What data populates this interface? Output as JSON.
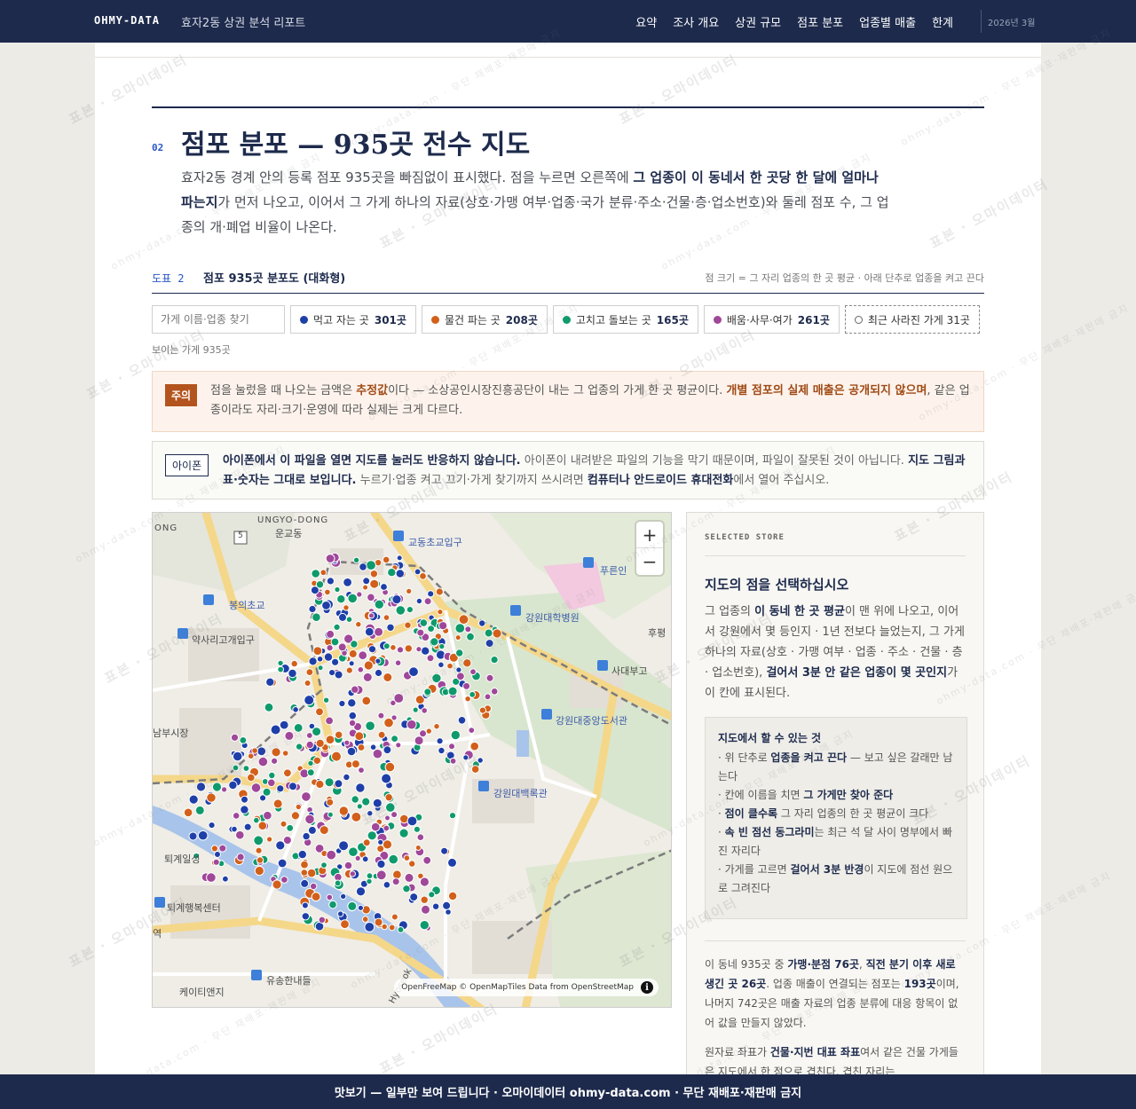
{
  "nav": {
    "brand": "OHMY-DATA",
    "subtitle": "효자2동 상권 분석 리포트",
    "links": [
      "요약",
      "조사 개요",
      "상권 규모",
      "점포 분포",
      "업종별 매출",
      "한계"
    ],
    "date": "2026년 3월"
  },
  "section": {
    "number": "02",
    "title": "점포 분포 — 935곳 전수 지도",
    "intro_1": "효자2동 경계 안의 등록 점포 935곳을 빠짐없이 표시했다. 점을 누르면 오른쪽에 ",
    "intro_bold": "그 업종이 이 동네서 한 곳당 한 달에 얼마나 파는지",
    "intro_2": "가 먼저 나오고, 이어서 그 가게 하나의 자료(상호·가맹 여부·업종·국가 분류·주소·건물·층·업소번호)와 둘레 점포 수, 그 업종의 개·폐업 비율이 나온다."
  },
  "figure": {
    "label": "도표 2",
    "title": "점포 935곳 분포도 (대화형)",
    "note": "점 크기 = 그 자리 업종의 한 곳 평균 · 아래 단추로 업종을 켜고 끈다"
  },
  "filters": {
    "search_placeholder": "가게 이름·업종 찾기",
    "chips": [
      {
        "label": "먹고 자는 곳",
        "count": "301곳",
        "color": "#1f3fa8"
      },
      {
        "label": "물건 파는 곳",
        "count": "208곳",
        "color": "#d2601a"
      },
      {
        "label": "고치고 돌보는 곳",
        "count": "165곳",
        "color": "#0f9a6c"
      },
      {
        "label": "배움·사무·여가",
        "count": "261곳",
        "color": "#a0479a"
      }
    ],
    "gone_label": "최근 사라진 가게 31곳",
    "visible_count": "보이는 가게 935곳"
  },
  "caution": {
    "tag": "주의",
    "t1": "점을 눌렀을 때 나오는 금액은 ",
    "b1": "추정값",
    "t2": "이다 — 소상공인시장진흥공단이 내는 그 업종의 가게 한 곳 평균이다. ",
    "b2": "개별 점포의 실제 매출은 공개되지 않으며",
    "t3": ", 같은 업종이라도 자리·크기·운영에 따라 실제는 크게 다르다."
  },
  "iphone": {
    "tag": "아이폰",
    "b1": "아이폰에서 이 파일을 열면 지도를 눌러도 반응하지 않습니다.",
    "t1": " 아이폰이 내려받은 파일의 기능을 막기 때문이며, 파일이 잘못된 것이 아닙니다. ",
    "b2": "지도 그림과 표·숫자는 그대로 보입니다.",
    "t2": " 누르기·업종 켜고 끄기·가게 찾기까지 쓰시려면 ",
    "b3": "컴퓨터나 안드로이드 휴대전화",
    "t3": "에서 열어 주십시오."
  },
  "map": {
    "zoom_in": "+",
    "zoom_out": "−",
    "attribution": "OpenFreeMap © OpenMapTiles Data from OpenStreetMap",
    "info": "i",
    "labels": {
      "ungyo": "UNGYO-DONG",
      "ungyo_kr": "운교동",
      "ong": "ONG",
      "route": "5",
      "gyodong": "교동초교입구",
      "purun": "푸른인",
      "bongui": "봉의초교",
      "gangwon_hosp": "강원대학병원",
      "yaksari": "약사리고개입구",
      "hubyeong": "후평",
      "sadae": "사대부고",
      "market": "남부시장",
      "library": "강원대중앙도서관",
      "baekrok": "강원대백록관",
      "toegye": "퇴계일성",
      "welfare": "퇴계행복센터",
      "yeok": "역",
      "yusong": "유송한내들",
      "ktand": "케이티앤지",
      "hyoseok": "Hyoseok"
    }
  },
  "side": {
    "kicker": "SELECTED STORE",
    "title": "지도의 점을 선택하십시오",
    "d1": "그 업종의 ",
    "db1": "이 동네 한 곳 평균",
    "d2": "이 맨 위에 나오고, 이어서 강원에서 몇 등인지 · 1년 전보다 늘었는지, 그 가게 하나의 자료(상호 · 가맹 여부 · 업종 · 주소 · 건물 · 층 · 업소번호), ",
    "db2": "걸어서 3분 안 같은 업종이 몇 곳인지",
    "d3": "가 이 칸에 표시된다.",
    "howto_title": "지도에서 할 수 있는 것",
    "howto": [
      {
        "pre": "· 위 단추로 ",
        "b": "업종을 켜고 끈다",
        "post": " — 보고 싶은 갈래만 남는다"
      },
      {
        "pre": "· 칸에 이름을 치면 ",
        "b": "그 가게만 찾아 준다",
        "post": ""
      },
      {
        "pre": "· ",
        "b": "점이 클수록",
        "post": " 그 자리 업종의 한 곳 평균이 크다"
      },
      {
        "pre": "· ",
        "b": "속 빈 점선 동그라미",
        "post": "는 최근 석 달 사이 명부에서 빠진 자리다"
      },
      {
        "pre": "· 가게를 고르면 ",
        "b": "걸어서 3분 반경",
        "post": "이 지도에 점선 원으로 그려진다"
      }
    ],
    "s1": "이 동네 935곳 중 ",
    "sb1": "가맹·분점 76곳",
    "s2": ", ",
    "sb2": "직전 분기 이후 새로 생긴 곳 26곳",
    "s3": ". 업종 매출이 연결되는 점포는 ",
    "sb3": "193곳",
    "s4": "이며, 나머지 742곳은 매출 자료의 업종 분류에 대응 항목이 없어 값을 만들지 않았다.",
    "r1": "원자료 좌표가 ",
    "rb1": "건물·지번 대표 좌표",
    "r2": "여서 같은 건물 가게들은 지도에서 한 점으로 겹친다. 겹친 자리는"
  },
  "watermark": {
    "main": "표본 · 오마이데이터",
    "small": "ohmy-data.com · 무단 재배포·재판매 금지"
  },
  "banner": "맛보기 — 일부만 보여 드립니다 · 오마이데이터 ohmy-data.com · 무단 재배포·재판매 금지"
}
